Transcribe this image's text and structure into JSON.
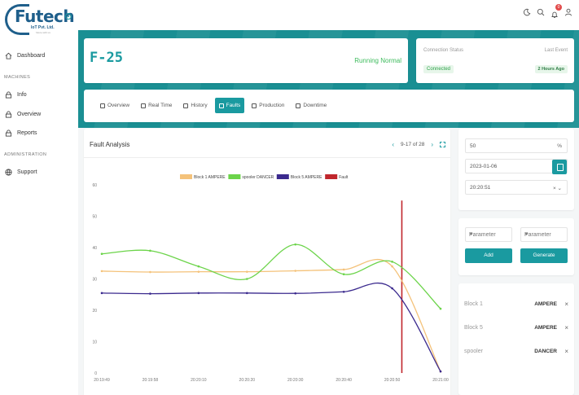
{
  "brand": {
    "name": "Futech",
    "sub": "IoT Pvt. Ltd.",
    "tagline": "future with us"
  },
  "sidebar": {
    "items": [
      {
        "label": "Dashboard",
        "icon": "home-icon"
      },
      {
        "label": "Info",
        "icon": "lock-icon"
      },
      {
        "label": "Overview",
        "icon": "lock-icon"
      },
      {
        "label": "Reports",
        "icon": "lock-icon"
      },
      {
        "label": "Support",
        "icon": "globe-icon"
      }
    ],
    "sections": {
      "machines": "MACHINES",
      "administration": "ADMINISTRATION"
    }
  },
  "topbar": {
    "notification_count": "0",
    "icons": [
      "moon-icon",
      "search-icon",
      "bell-icon",
      "user-icon"
    ]
  },
  "machine": {
    "title": "F-25",
    "status": "Running Normal"
  },
  "connection": {
    "label": "Connection Status",
    "value": "Connected",
    "last_event_label": "Last Event",
    "last_event_value": "2 Hours Ago"
  },
  "tabs": [
    {
      "label": "Overview",
      "active": false
    },
    {
      "label": "Real Time",
      "active": false
    },
    {
      "label": "History",
      "active": false
    },
    {
      "label": "Faults",
      "active": true
    },
    {
      "label": "Production",
      "active": false
    },
    {
      "label": "Downtime",
      "active": false
    }
  ],
  "fault_panel": {
    "title": "Fault Analysis",
    "pager": "9-17 of 28"
  },
  "form": {
    "value": "50",
    "unit": "%",
    "date": "2023-01-06",
    "time": "20:20:51"
  },
  "params": {
    "select1": "Parameter",
    "select2": "Parameter",
    "add_label": "Add",
    "generate_label": "Generate"
  },
  "selected_params": [
    {
      "name": "Block 1",
      "unit": "AMPERE"
    },
    {
      "name": "Block 5",
      "unit": "AMPERE"
    },
    {
      "name": "spooler",
      "unit": "DANCER"
    }
  ],
  "colors": {
    "accent": "#1a9aa0",
    "success": "#3dbb5c",
    "fault": "#c0262c"
  },
  "chart_data": {
    "type": "line",
    "x": [
      "20:19:49",
      "20:19:59",
      "20:20:09",
      "20:20:19",
      "20:20:29",
      "20:20:39",
      "20:20:49",
      "20:20:59"
    ],
    "x_ticks": [
      "20:19:49",
      "20:19:58",
      "20:20:10",
      "20:20:20",
      "20:20:30",
      "20:20:40",
      "20:20:50",
      "20:21:00"
    ],
    "ylim": [
      0,
      60
    ],
    "y_ticks": [
      "0",
      "10",
      "20",
      "30",
      "40",
      "50",
      "60"
    ],
    "series": [
      {
        "name": "Block 1 AMPERE",
        "color": "#f4c27a",
        "values": [
          32.5,
          32.2,
          32.3,
          32.3,
          32.6,
          33,
          34,
          0.5
        ]
      },
      {
        "name": "spooler DANCER",
        "color": "#6cd44a",
        "values": [
          38,
          39,
          34,
          30,
          41,
          31.5,
          35.5,
          20.5
        ]
      },
      {
        "name": "Block 5 AMPERE",
        "color": "#3b2a8e",
        "values": [
          25.5,
          25.3,
          25.5,
          25.5,
          25.4,
          25.9,
          27,
          0.5
        ]
      }
    ],
    "fault": {
      "name": "Fault",
      "color": "#c0262c",
      "x": "20:20:51"
    },
    "legend": "top-center",
    "grid": false
  }
}
